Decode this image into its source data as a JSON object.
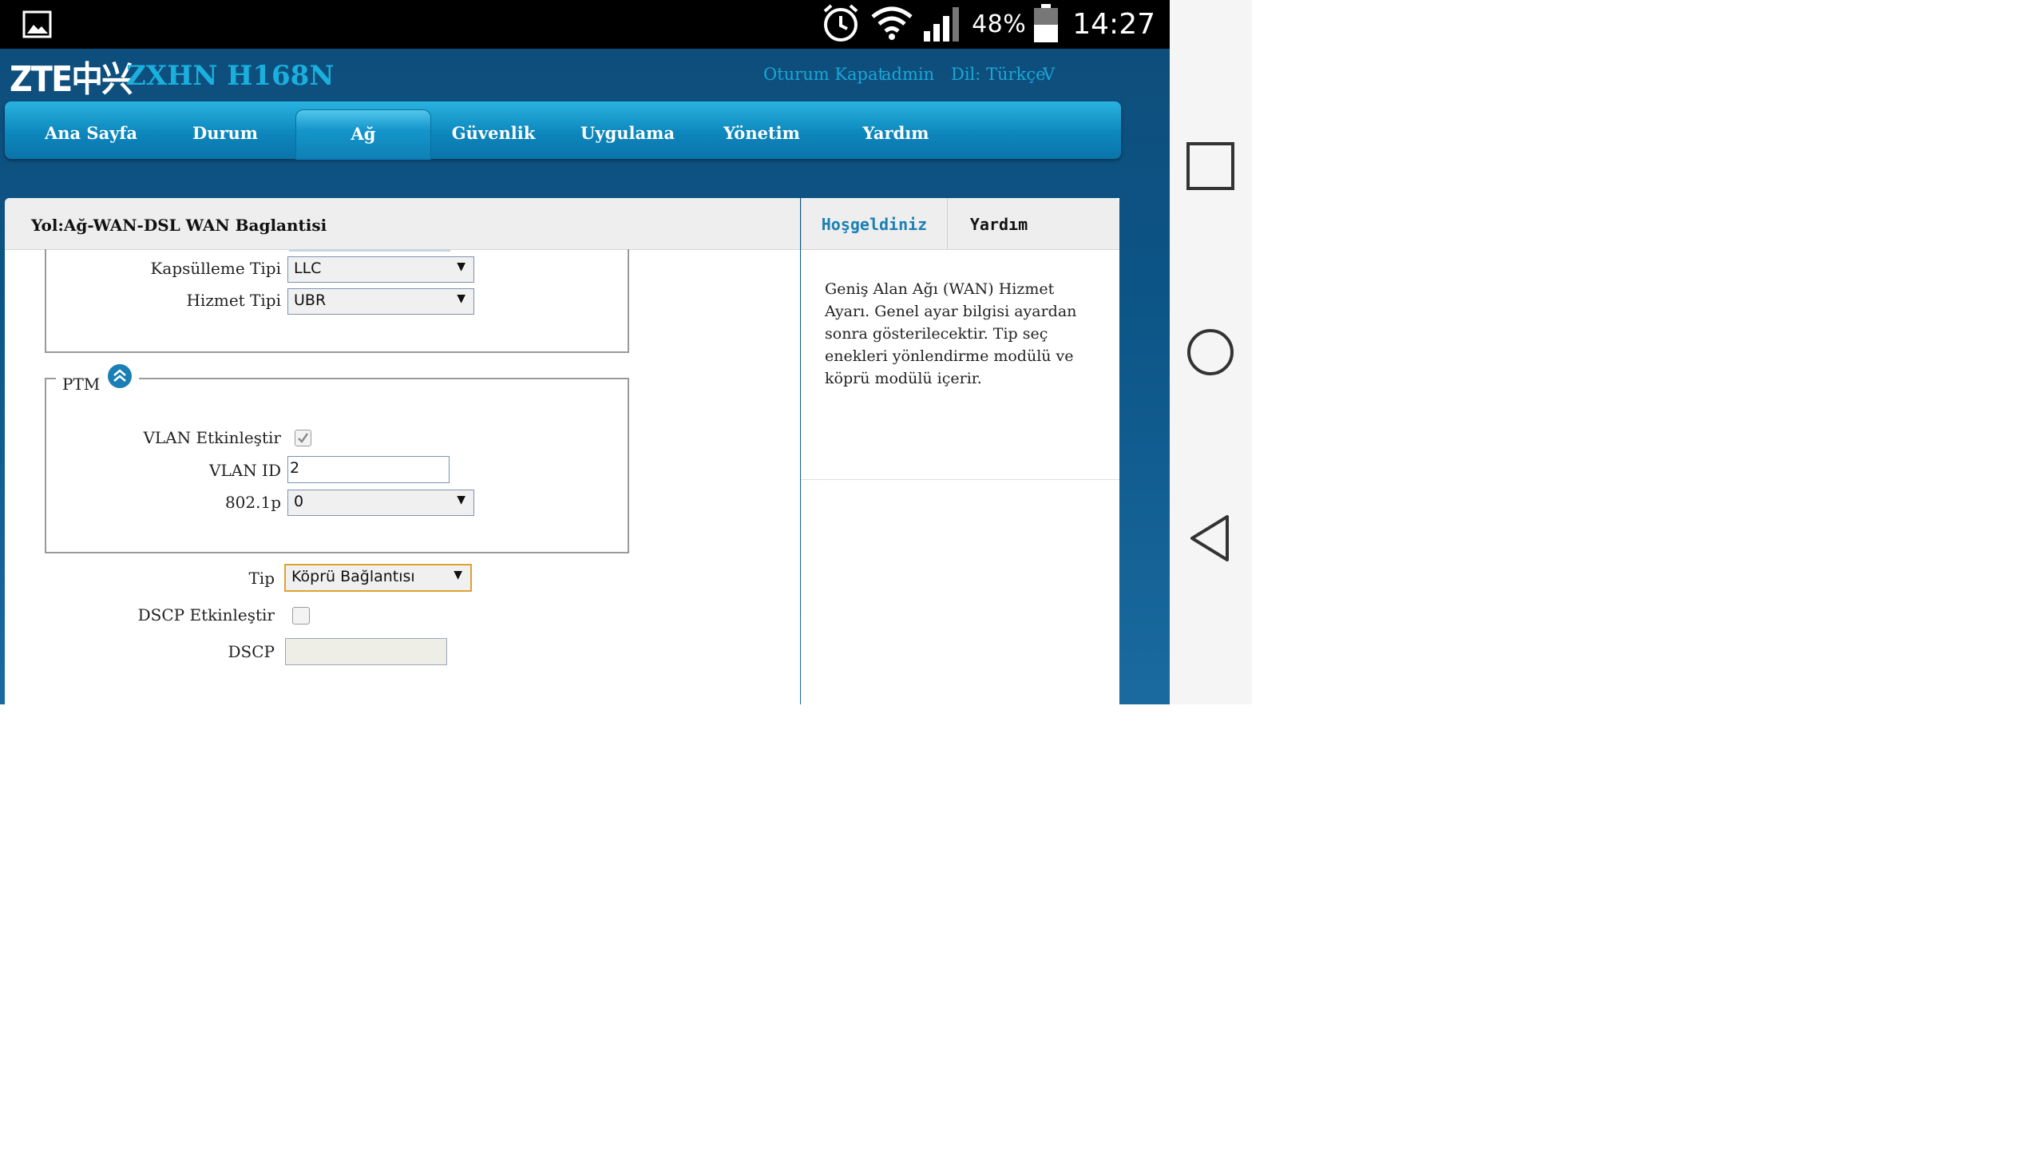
{
  "status_bar": {
    "battery_percent": "48%",
    "time": "14:27",
    "icons": [
      "gallery-icon",
      "alarm-icon",
      "wifi-icon",
      "signal-icon",
      "battery-icon"
    ]
  },
  "header": {
    "logo": "ZTE中兴",
    "model": "ZXHN H168N",
    "logout": "Oturum Kapat",
    "user": "admin",
    "language": "Dil: Türkçe",
    "language_chevron": "V"
  },
  "menu": {
    "items": [
      "Ana Sayfa",
      "Durum",
      "Ağ",
      "Güvenlik",
      "Uygulama",
      "Yönetim",
      "Yardım"
    ],
    "active": "Ağ"
  },
  "breadcrumb": "Yol:Ağ-WAN-DSL WAN Baglantisi",
  "form": {
    "encapsulation_label": "Kapsülleme Tipi",
    "encapsulation_value": "LLC",
    "service_label": "Hizmet Tipi",
    "service_value": "UBR",
    "ptm_legend": "PTM",
    "vlan_enable_label": "VLAN Etkinleştir",
    "vlan_enabled": true,
    "vlan_id_label": "VLAN ID",
    "vlan_id_value": "2",
    "dot1p_label": "802.1p",
    "dot1p_value": "0",
    "type_label": "Tip",
    "type_value": "Köprü Bağlantısı",
    "dscp_enable_label": "DSCP Etkinleştir",
    "dscp_enabled": false,
    "dscp_label": "DSCP",
    "dscp_value": ""
  },
  "help": {
    "tab_welcome": "Hoşgeldiniz",
    "tab_help": "Yardım",
    "text": "Geniş Alan Ağı (WAN) Hizmet Ayarı. Genel ayar bilgisi ayardan sonra gösterilecektir. Tip seç enekleri yönlendirme modülü ve köprü modülü içerir."
  },
  "colors": {
    "accent": "#1ab0de",
    "menu_bar": "#0d87bd",
    "header_bg": "#0e4e7c",
    "select_focus": "#e0a030"
  }
}
